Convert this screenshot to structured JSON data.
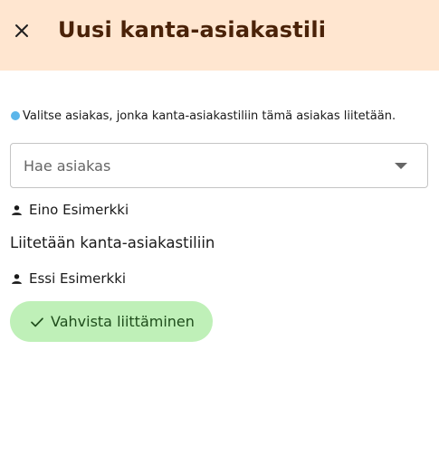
{
  "header": {
    "title": "Uusi kanta-asiakastili",
    "close_icon": "close-icon",
    "background": "#ffe6d0",
    "title_color": "#4a2208"
  },
  "info": {
    "text": "Valitse asiakas, jonka kanta-asiakastiliin tämä asiakas liitetään.",
    "icon": "info-dot-icon",
    "icon_color": "#5cb6ea"
  },
  "search": {
    "placeholder": "Hae asiakas",
    "value": "",
    "icon": "chevron-down-icon"
  },
  "customers": {
    "primary": {
      "name": "Eino Esimerkki",
      "icon": "person-icon"
    },
    "link_label": "Liitetään kanta-asiakastiliin",
    "secondary": {
      "name": "Essi Esimerkki",
      "icon": "person-icon"
    }
  },
  "confirm": {
    "label": "Vahvista liittäminen",
    "icon": "check-icon",
    "background": "#bff0b8"
  }
}
